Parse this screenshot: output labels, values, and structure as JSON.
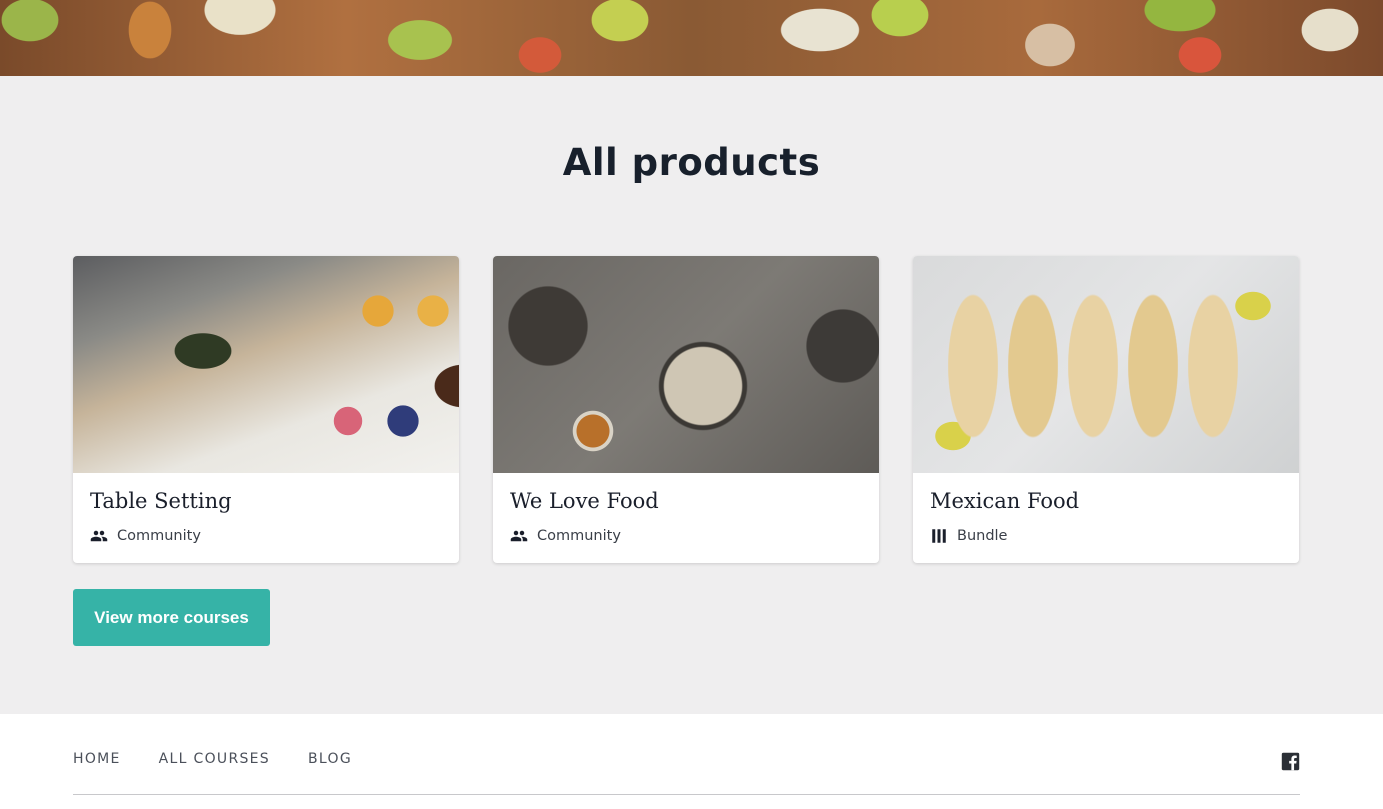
{
  "section": {
    "title": "All products"
  },
  "products": [
    {
      "name": "Table Setting",
      "type": "Community",
      "icon": "community-icon"
    },
    {
      "name": "We Love Food",
      "type": "Community",
      "icon": "community-icon"
    },
    {
      "name": "Mexican Food",
      "type": "Bundle",
      "icon": "bundle-icon"
    }
  ],
  "actions": {
    "view_more_label": "View more courses"
  },
  "footer": {
    "nav": [
      "HOME",
      "ALL COURSES",
      "BLOG"
    ],
    "social_icon": "facebook-icon"
  },
  "colors": {
    "accent": "#36b3a7",
    "background": "#efeeef",
    "card": "#ffffff"
  }
}
